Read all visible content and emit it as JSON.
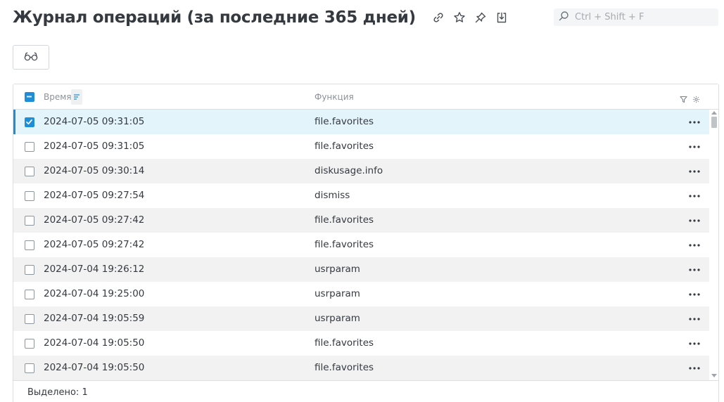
{
  "header": {
    "title": "Журнал операций (за последние 365 дней)"
  },
  "icons": {
    "link": "link-icon",
    "star": "star-icon",
    "pin": "pin-icon",
    "export": "export-icon",
    "search": "search-icon",
    "view": "glasses-icon",
    "sort": "sort-icon",
    "filter": "filter-icon",
    "settings": "gear-icon",
    "more": "more-icon"
  },
  "search": {
    "placeholder": "Ctrl + Shift + F",
    "value": ""
  },
  "colors": {
    "accent": "#1f8ed8",
    "selected_row": "#e4f4fb",
    "alt_row": "#f2f2f2",
    "title": "#343a40"
  },
  "grid": {
    "columns": [
      "Время",
      "Функция"
    ],
    "rows": [
      {
        "time": "2024-07-05 09:31:05",
        "function": "file.favorites",
        "checked": true
      },
      {
        "time": "2024-07-05 09:31:05",
        "function": "file.favorites",
        "checked": false
      },
      {
        "time": "2024-07-05 09:30:14",
        "function": "diskusage.info",
        "checked": false
      },
      {
        "time": "2024-07-05 09:27:54",
        "function": "dismiss",
        "checked": false
      },
      {
        "time": "2024-07-05 09:27:42",
        "function": "file.favorites",
        "checked": false
      },
      {
        "time": "2024-07-05 09:27:42",
        "function": "file.favorites",
        "checked": false
      },
      {
        "time": "2024-07-04 19:26:12",
        "function": "usrparam",
        "checked": false
      },
      {
        "time": "2024-07-04 19:25:00",
        "function": "usrparam",
        "checked": false
      },
      {
        "time": "2024-07-04 19:05:59",
        "function": "usrparam",
        "checked": false
      },
      {
        "time": "2024-07-04 19:05:50",
        "function": "file.favorites",
        "checked": false
      },
      {
        "time": "2024-07-04 19:05:50",
        "function": "file.favorites",
        "checked": false
      }
    ],
    "footer": "Выделено: 1"
  }
}
